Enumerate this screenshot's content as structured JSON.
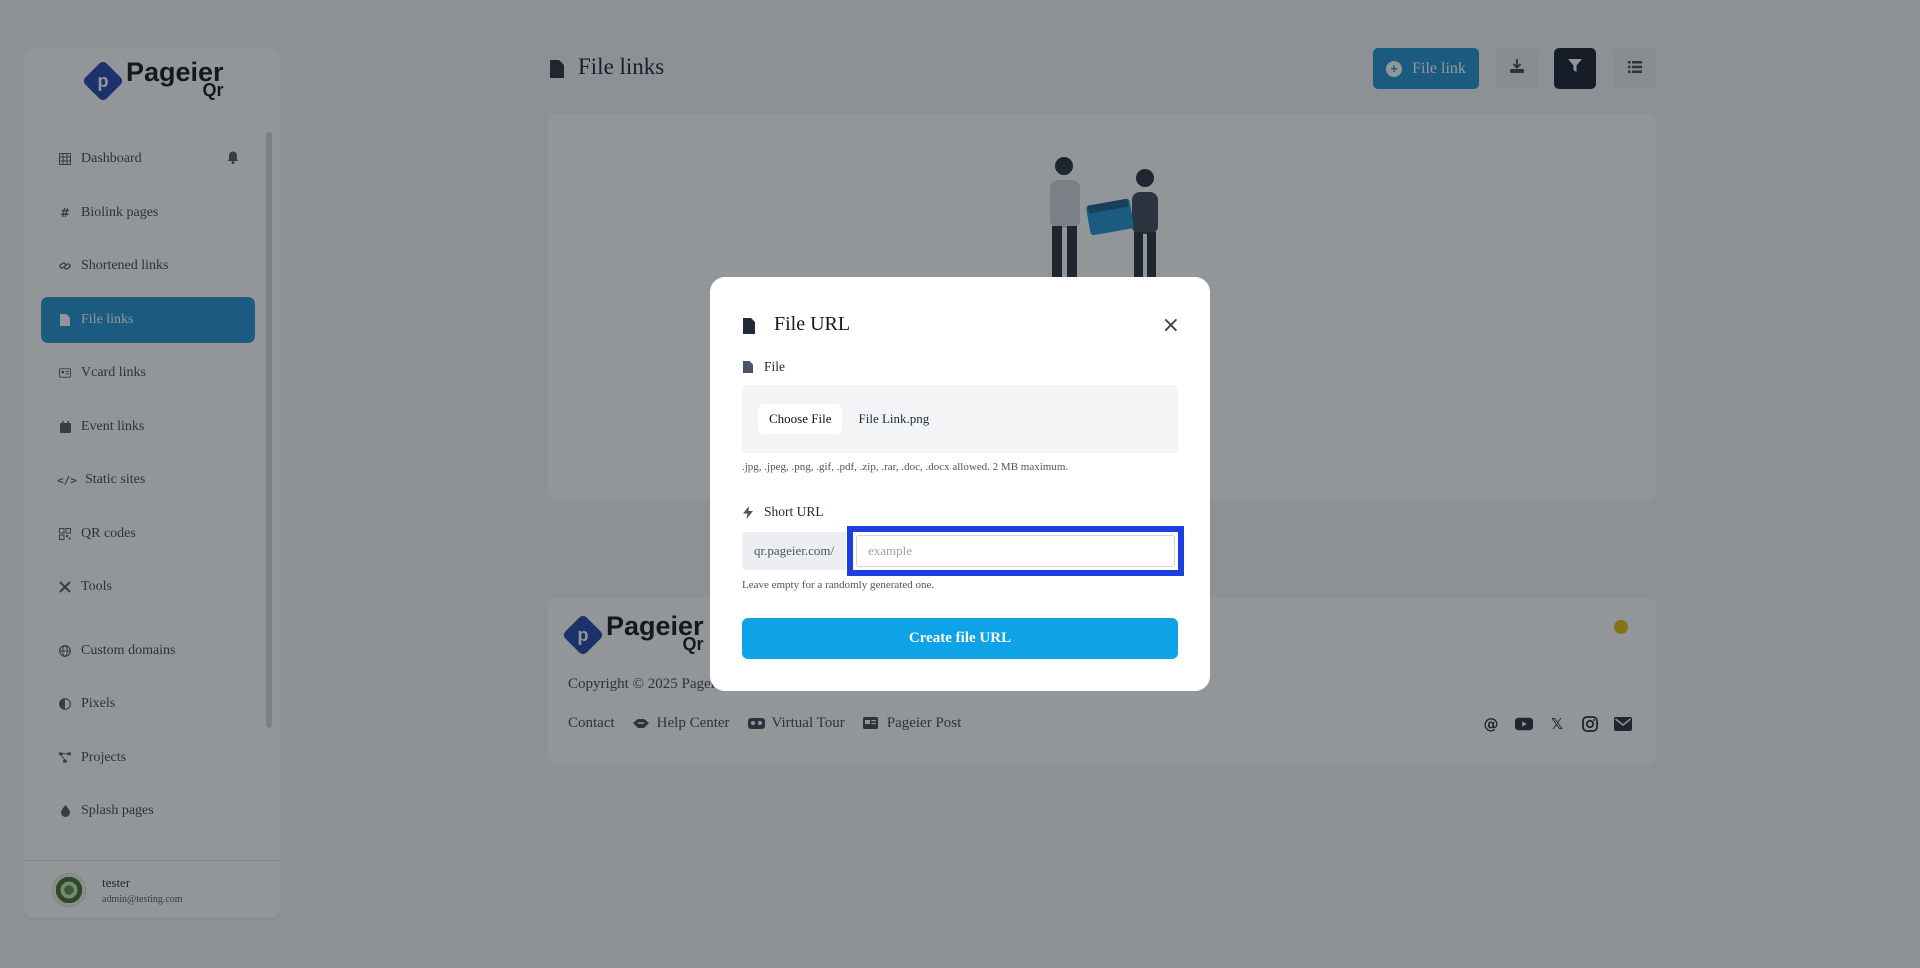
{
  "sidebar": {
    "logo": {
      "mark": "p",
      "line1": "Pageier",
      "line2": "Qr"
    },
    "items": [
      {
        "label": "Dashboard",
        "icon": "table-icon"
      },
      {
        "label": "Biolink pages",
        "icon": "hashtag-icon"
      },
      {
        "label": "Shortened links",
        "icon": "link-icon"
      },
      {
        "label": "File links",
        "icon": "file-icon",
        "active": true
      },
      {
        "label": "Vcard links",
        "icon": "id-card-icon"
      },
      {
        "label": "Event links",
        "icon": "calendar-icon"
      },
      {
        "label": "Static sites",
        "icon": "code-icon"
      },
      {
        "label": "QR codes",
        "icon": "qrcode-icon"
      },
      {
        "label": "Tools",
        "icon": "tools-icon"
      },
      {
        "label": "Custom domains",
        "icon": "globe-icon"
      },
      {
        "label": "Pixels",
        "icon": "adjust-icon"
      },
      {
        "label": "Projects",
        "icon": "project-diagram-icon"
      },
      {
        "label": "Splash pages",
        "icon": "droplet-icon"
      }
    ],
    "user": {
      "name": "tester",
      "email": "admin@testing.com"
    }
  },
  "header": {
    "title": "File links",
    "primary_button": "File link"
  },
  "footer": {
    "copyright": "Copyright © 2025 Pageier Qr",
    "links": [
      "Contact",
      "Help Center",
      "Virtual Tour",
      "Pageier Post"
    ],
    "social": [
      "threads-icon",
      "youtube-icon",
      "x-icon",
      "instagram-icon",
      "envelope-icon"
    ]
  },
  "modal": {
    "title": "File URL",
    "file_label": "File",
    "choose_button": "Choose File",
    "file_name": "File Link.png",
    "file_help": ".jpg, .jpeg, .png, .gif, .pdf, .zip, .rar, .doc, .docx allowed. 2 MB maximum.",
    "short_url_label": "Short URL",
    "url_prefix": "qr.pageier.com/",
    "url_placeholder": "example",
    "url_help": "Leave empty for a randomly generated one.",
    "submit": "Create file URL",
    "close": "×"
  },
  "colors": {
    "accent": "#1a8fd0",
    "submit": "#0ea2e6",
    "focus_highlight": "#1d3ee0",
    "logo": "#1e3ea6"
  }
}
